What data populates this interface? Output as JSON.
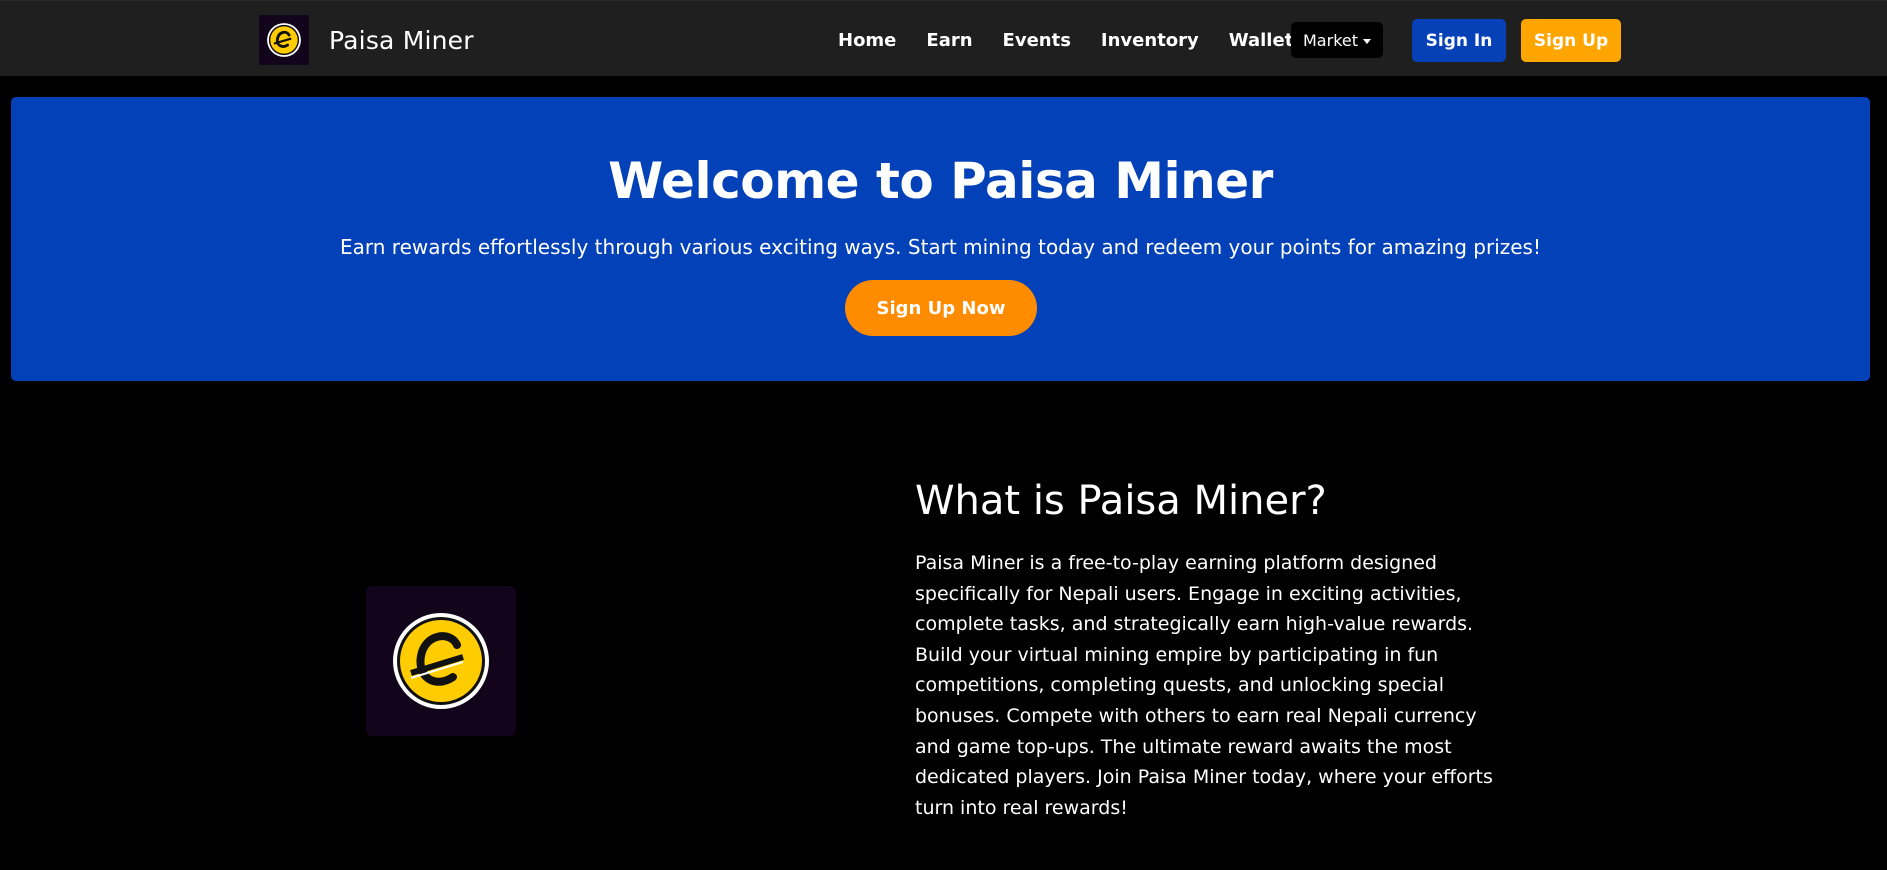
{
  "brand": {
    "name": "Paisa Miner",
    "logo_icon": "coin-e-icon",
    "coin_color": "#ffcc00"
  },
  "nav": {
    "links": [
      "Home",
      "Earn",
      "Events",
      "Inventory",
      "Wallet"
    ],
    "market_label": "Market",
    "signin_label": "Sign In",
    "signup_label": "Sign Up"
  },
  "hero": {
    "title": "Welcome to Paisa Miner",
    "subtitle": "Earn rewards effortlessly through various exciting ways. Start mining today and redeem your points for amazing prizes!",
    "cta_label": "Sign Up Now",
    "background": "#0341b8"
  },
  "about": {
    "title": "What is Paisa Miner?",
    "text": "Paisa Miner is a free-to-play earning platform designed specifically for Nepali users. Engage in exciting activities, complete tasks, and strategically earn high-value rewards. Build your virtual mining empire by participating in fun competitions, completing quests, and unlocking special bonuses. Compete with others to earn real Nepali currency and game top-ups. The ultimate reward awaits the most dedicated players. Join Paisa Miner today, where your efforts turn into real rewards!"
  },
  "colors": {
    "navbar": "#1f1f1f",
    "signin": "#0641b8",
    "signup": "#ffa500",
    "cta": "#ff8c00"
  }
}
